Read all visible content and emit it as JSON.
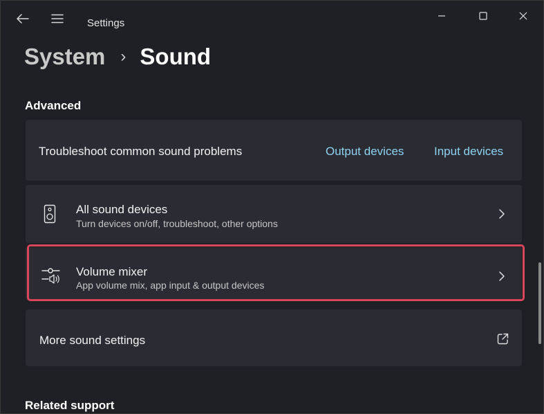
{
  "window": {
    "app_title": "Settings",
    "icons": [
      "back-arrow-icon",
      "hamburger-menu-icon",
      "minimize-icon",
      "maximize-icon",
      "close-icon"
    ]
  },
  "breadcrumb": {
    "parent": "System",
    "separator": "›",
    "current": "Sound"
  },
  "advanced": {
    "heading": "Advanced",
    "troubleshoot": {
      "label": "Troubleshoot common sound problems",
      "link_output": "Output devices",
      "link_input": "Input devices"
    },
    "all_devices": {
      "title": "All sound devices",
      "subtitle": "Turn devices on/off, troubleshoot, other options",
      "icon": "speaker-device-icon"
    },
    "volume_mixer": {
      "title": "Volume mixer",
      "subtitle": "App volume mix, app input & output devices",
      "icon": "volume-mixer-icon"
    },
    "more_settings": {
      "title": "More sound settings",
      "icon": "open-external-icon"
    }
  },
  "related": {
    "heading": "Related support"
  },
  "colors": {
    "background": "#1f1f26",
    "card": "#2b2b33",
    "link": "#8cd3f0",
    "highlight": "#d9465a"
  }
}
